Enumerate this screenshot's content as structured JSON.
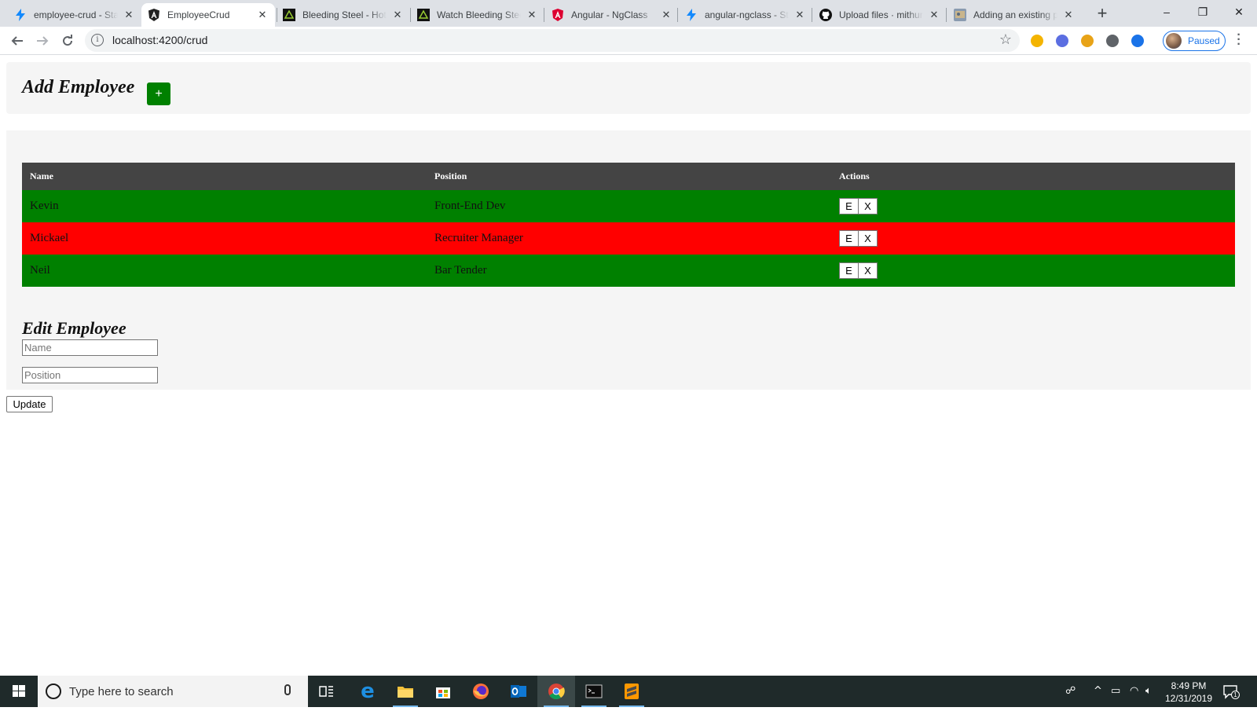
{
  "browser": {
    "tabs": [
      {
        "title": "employee-crud - Sta",
        "icon": "stackblitz-bolt-icon",
        "active": false
      },
      {
        "title": "EmployeeCrud",
        "icon": "angular-icon",
        "active": true
      },
      {
        "title": "Bleeding Steel - Hot",
        "icon": "movie-site-icon",
        "active": false
      },
      {
        "title": "Watch Bleeding Stee",
        "icon": "movie-site-icon",
        "active": false
      },
      {
        "title": "Angular - NgClass",
        "icon": "angular-red-icon",
        "active": false
      },
      {
        "title": "angular-ngclass - St",
        "icon": "stackblitz-bolt-icon",
        "active": false
      },
      {
        "title": "Upload files · mithur",
        "icon": "github-icon",
        "active": false
      },
      {
        "title": "Adding an existing p",
        "icon": "site-thumbnail-icon",
        "active": false
      }
    ],
    "url": "localhost:4200/crud",
    "profile_status": "Paused"
  },
  "page": {
    "add_title": "Add Employee",
    "add_button": "+",
    "table": {
      "headers": [
        "Name",
        "Position",
        "Actions"
      ],
      "rows": [
        {
          "name": "Kevin",
          "position": "Front-End Dev",
          "status": "green"
        },
        {
          "name": "Mickael",
          "position": "Recruiter Manager",
          "status": "red"
        },
        {
          "name": "Neil",
          "position": "Bar Tender",
          "status": "green"
        }
      ],
      "edit_button": "E",
      "delete_button": "X"
    },
    "edit_title": "Edit Employee",
    "name_placeholder": "Name",
    "position_placeholder": "Position",
    "update_button": "Update"
  },
  "taskbar": {
    "search_placeholder": "Type here to search",
    "time": "8:49 PM",
    "date": "12/31/2019",
    "notification_count": "1"
  },
  "colors": {
    "row_green": "#008000",
    "row_red": "#ff0000",
    "header_dark": "#444444",
    "add_button_green": "#008000"
  }
}
